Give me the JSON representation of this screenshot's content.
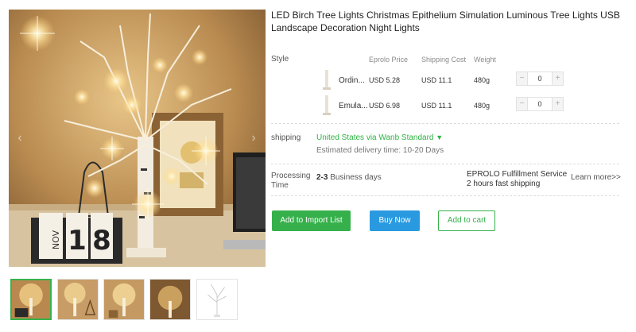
{
  "product": {
    "title": "LED Birch Tree Lights Christmas Epithelium Simulation Luminous Tree Lights USB Landscape Decoration Night Lights"
  },
  "gallery": {
    "prev_glyph": "‹",
    "next_glyph": "›",
    "clock_digits": [
      "1",
      "8"
    ],
    "clock_month": "NOV",
    "thumbnail_count": 5,
    "active_thumbnail": 0
  },
  "style": {
    "label": "Style",
    "columns": {
      "price": "Eprolo Price",
      "shipping": "Shipping Cost",
      "weight": "Weight"
    },
    "variants": [
      {
        "name": "Ordin...",
        "price": "USD 5.28",
        "shipping": "USD 11.1",
        "weight": "480g",
        "quantity": "0"
      },
      {
        "name": "Emula...",
        "price": "USD 6.98",
        "shipping": "USD 11.1",
        "weight": "480g",
        "quantity": "0"
      }
    ],
    "minus_glyph": "−",
    "plus_glyph": "+"
  },
  "shipping": {
    "label": "shipping",
    "method": "United States via Wanb Standard",
    "dropdown_glyph": "▼",
    "estimate": "Estimated delivery time: 10-20 Days"
  },
  "processing": {
    "label": "Processing Time",
    "days_value": "2-3",
    "days_unit": "Business days",
    "fulfillment_line1": "EPROLO Fulfillment Service",
    "fulfillment_line2": "2 hours fast shipping",
    "learn_more": "Learn more>>"
  },
  "actions": {
    "import": "Add to Import List",
    "buy": "Buy Now",
    "cart": "Add to cart"
  },
  "colors": {
    "accent_green": "#36b04b",
    "accent_blue": "#2a9ae0",
    "warm_light": "#f5d680"
  }
}
